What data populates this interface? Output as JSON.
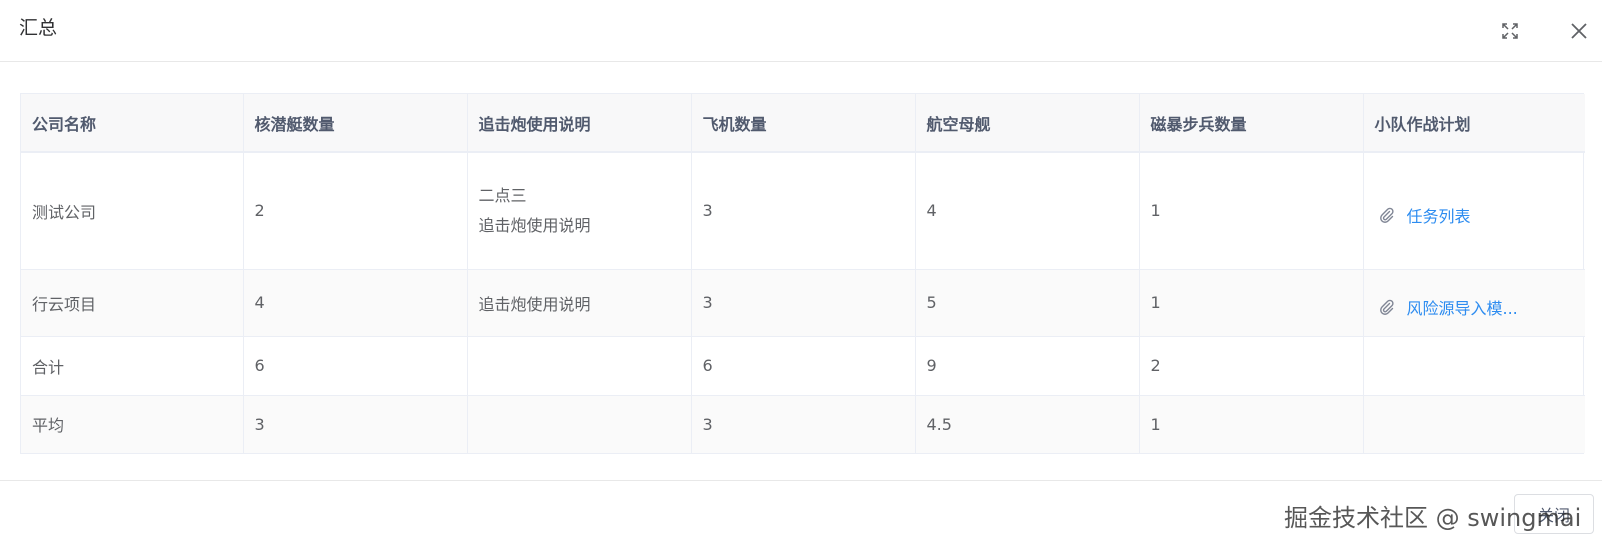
{
  "dialog": {
    "title": "汇总",
    "fullscreen_icon": "fullscreen-icon",
    "close_icon": "close-icon"
  },
  "table": {
    "columns": [
      "公司名称",
      "核潜艇数量",
      "追击炮使用说明",
      "飞机数量",
      "航空母舰",
      "磁暴步兵数量",
      "小队作战计划"
    ],
    "rows": [
      {
        "company": "测试公司",
        "submarines": "2",
        "mortar_line1": "二点三",
        "mortar_line2": "追击炮使用说明",
        "planes": "3",
        "carriers": "4",
        "tesla": "1",
        "plan": "任务列表"
      },
      {
        "company": "行云项目",
        "submarines": "4",
        "mortar_line1": "追击炮使用说明",
        "planes": "3",
        "carriers": "5",
        "tesla": "1",
        "plan": "风险源导入模..."
      }
    ],
    "summary": {
      "label": "合计",
      "submarines": "6",
      "planes": "6",
      "carriers": "9",
      "tesla": "2"
    },
    "average": {
      "label": "平均",
      "submarines": "3",
      "planes": "3",
      "carriers": "4.5",
      "tesla": "1"
    }
  },
  "footer": {
    "close_label": "关闭"
  },
  "watermark": "掘金技术社区 @ swingmai",
  "colors": {
    "link": "#2d8cf0",
    "header_bg": "#f8f8f9",
    "border": "#ebeef5"
  }
}
